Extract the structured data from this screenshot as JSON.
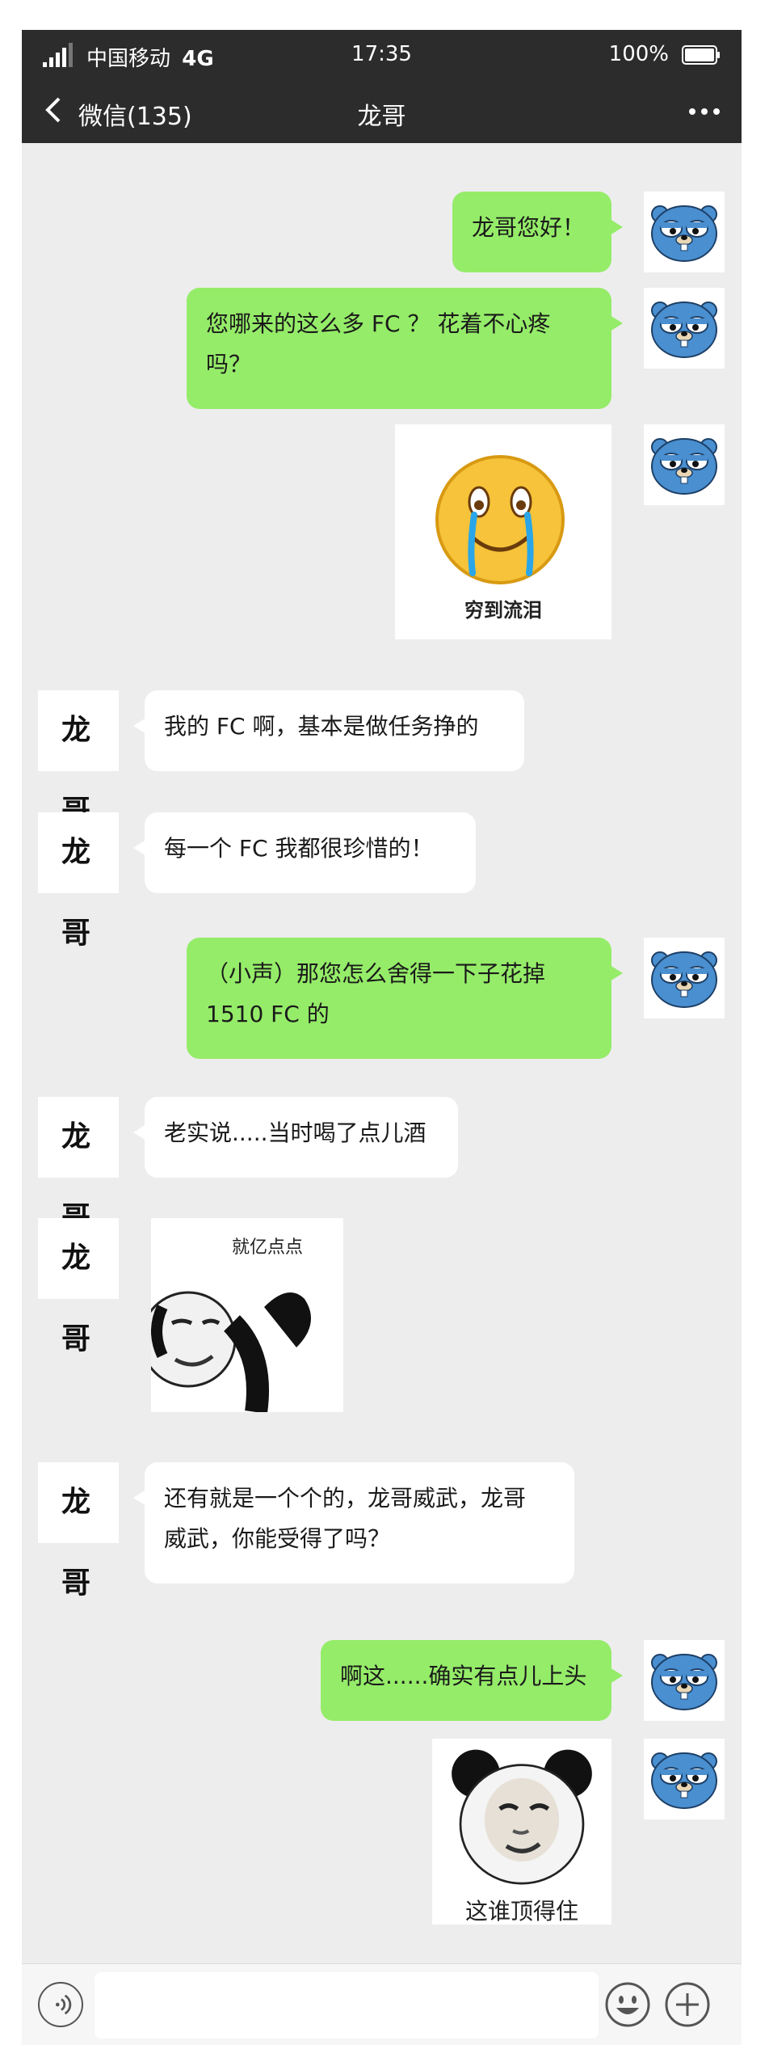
{
  "status_bar": {
    "carrier": "中国移动",
    "network": "4G",
    "time": "17:35",
    "battery": "100%"
  },
  "nav": {
    "back_label": "微信(135)",
    "title": "龙哥"
  },
  "contact_avatar_text": "龙 哥",
  "messages": [
    {
      "from": "me",
      "text": "龙哥您好！"
    },
    {
      "from": "me",
      "text_line1": "您哪来的这么多 FC ？ 花着不心疼",
      "text_line2": "吗？"
    },
    {
      "from": "me",
      "image": "crying-laughing-emoji-sticker",
      "caption": "穷到流泪"
    },
    {
      "from": "them",
      "text": "我的 FC 啊，基本是做任务挣的"
    },
    {
      "from": "them",
      "text": "每一个 FC 我都很珍惜的！"
    },
    {
      "from": "me",
      "text_line1": "（小声）那您怎么舍得一下子花掉",
      "text_line2": "1510 FC 的"
    },
    {
      "from": "them",
      "text": "老实说.....当时喝了点儿酒"
    },
    {
      "from": "them",
      "image": "panda-meme-sticker",
      "caption": "就亿点点"
    },
    {
      "from": "them",
      "text_line1": "还有就是一个个的，龙哥威武，龙哥",
      "text_line2": "威武，你能受得了吗？"
    },
    {
      "from": "me",
      "text": "啊这......确实有点儿上头"
    },
    {
      "from": "me",
      "image": "panda-meme-sticker",
      "caption": "这谁顶得住"
    }
  ],
  "colors": {
    "my_bubble": "#95ec69",
    "their_bubble": "#ffffff",
    "background": "#ededed",
    "header": "#2c2c2c",
    "gopher_blue": "#4a8fd0"
  }
}
